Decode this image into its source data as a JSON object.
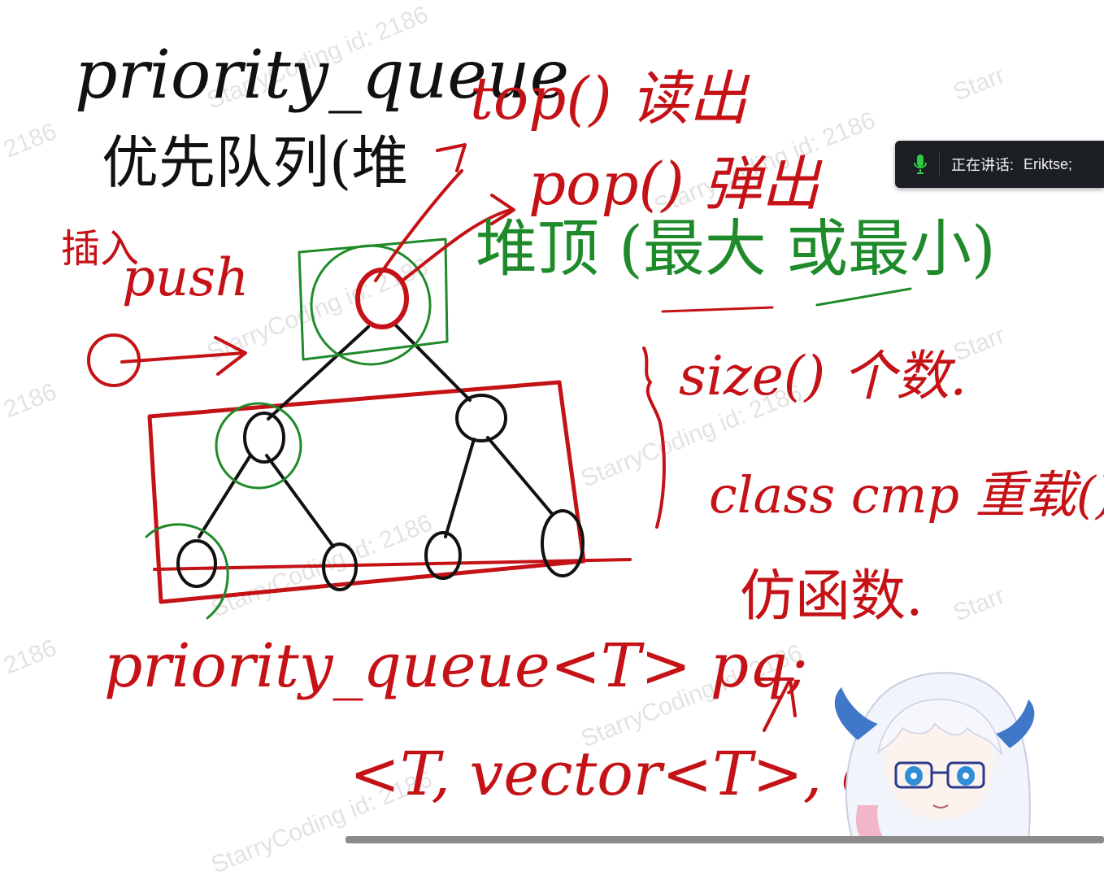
{
  "whiteboard": {
    "black_title": "priority_queue",
    "black_subtitle": "优先队列(堆",
    "push_cn": "插入",
    "push_label": "push",
    "top_label": "top() 读出",
    "pop_label": "pop() 弹出",
    "heap_top_label": "堆顶 (最大 或最小)",
    "size_label": "size() 个数.",
    "class_cmp_label": "class cmp 重载()",
    "functor_label": "仿函数.",
    "declaration": "priority_queue<T> pq;",
    "template_args": "<T, vector<T>, cmp",
    "colors": {
      "black": "#111111",
      "red": "#c41216",
      "green": "#1e8a2a"
    }
  },
  "watermark": {
    "texts": [
      "StarryCoding id: 2186",
      "2186",
      "Starr"
    ]
  },
  "speaking_toast": {
    "icon": "microphone-icon",
    "label": "正在讲话:",
    "speaker": "Eriktse;"
  }
}
